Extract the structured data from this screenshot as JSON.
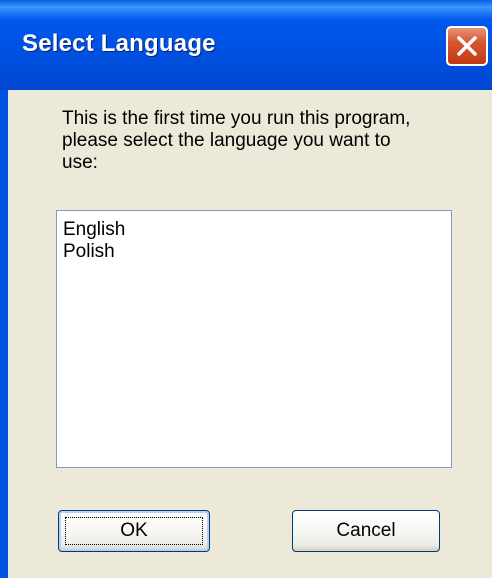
{
  "window": {
    "title": "Select Language",
    "close_icon": "close-icon"
  },
  "dialog": {
    "message": "This is the first time you run this program,\nplease select the language you want to\nuse:",
    "languages": [
      "English",
      "Polish"
    ]
  },
  "buttons": {
    "ok_label": "OK",
    "cancel_label": "Cancel"
  },
  "colors": {
    "titlebar": "#0054e3",
    "dialog_bg": "#ece9d8",
    "close_button": "#d65530"
  }
}
